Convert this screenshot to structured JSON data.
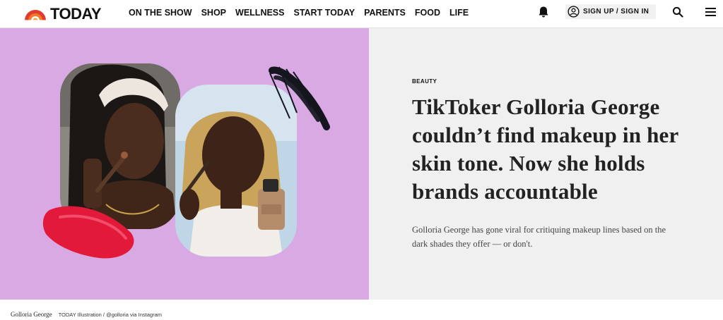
{
  "header": {
    "logo": {
      "text": "TODAY",
      "colors": {
        "red": "#e23b2e",
        "orange": "#f07a2b"
      }
    },
    "nav": [
      "ON THE SHOW",
      "SHOP",
      "WELLNESS",
      "START TODAY",
      "PARENTS",
      "FOOD",
      "LIFE"
    ],
    "signin": "SIGN UP / SIGN IN",
    "icons": {
      "bell": "bell-icon",
      "user": "user-icon",
      "search": "search-icon",
      "menu": "menu-icon"
    }
  },
  "hero": {
    "background_color": "#d9a9e4",
    "label": "BEAUTY",
    "headline": "TikToker Golloria George couldn’t find makeup in her skin tone. Now she holds brands accountable",
    "dek": "Golloria George has gone viral for critiquing makeup lines based on the dark shades they offer — or don't."
  },
  "caption": {
    "name": "Golloria George",
    "credit": "TODAY Illustration / @golloria via Instagram"
  }
}
